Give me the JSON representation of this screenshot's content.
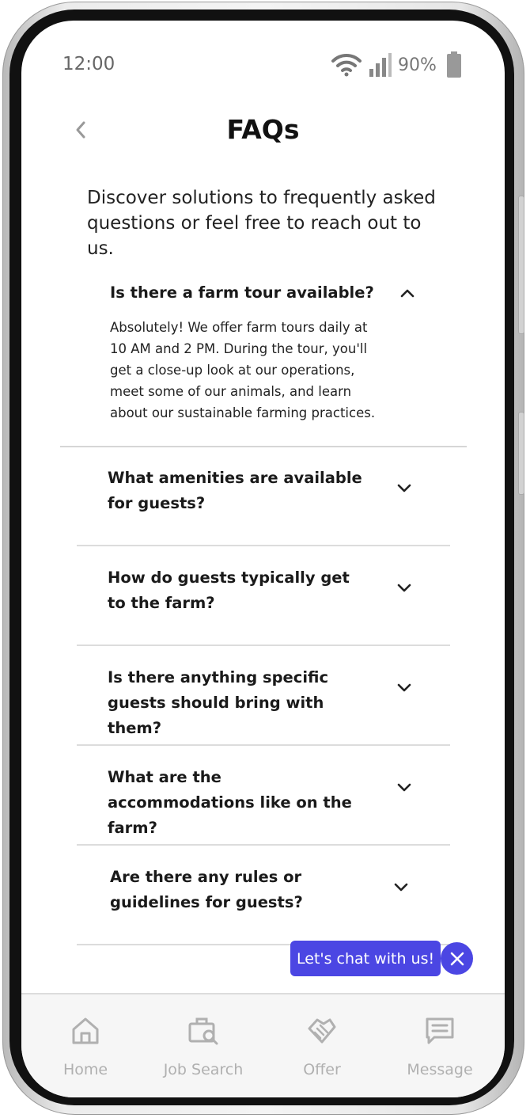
{
  "status_bar": {
    "time": "12:00",
    "battery_percent": "90%",
    "icons": [
      "wifi-icon",
      "signal-icon",
      "battery-icon"
    ]
  },
  "header": {
    "title": "FAQs",
    "back_icon": "chevron-left-icon"
  },
  "intro": "Discover solutions to frequently asked questions or feel free to reach out to us.",
  "faqs": {
    "open": {
      "question": "Is there a farm tour available?",
      "answer": "Absolutely! We offer farm tours daily at 10 AM and 2 PM. During the tour, you'll get a close-up look at our operations, meet some of our animals, and learn about our sustainable farming practices."
    },
    "items": [
      {
        "question": "What amenities are available for guests?"
      },
      {
        "question": "How do guests typically get to the farm?"
      },
      {
        "question": "Is there anything specific guests should bring with them?"
      },
      {
        "question": "What are the accommodations like on the farm?"
      },
      {
        "question": "Are there any rules or guidelines for guests?"
      }
    ]
  },
  "chat": {
    "label": "Let's chat with us!",
    "close_icon": "close-icon"
  },
  "tabbar": {
    "tabs": [
      {
        "label": "Home",
        "icon": "home-icon"
      },
      {
        "label": "Job Search",
        "icon": "job-search-icon"
      },
      {
        "label": "Offer",
        "icon": "handshake-icon"
      },
      {
        "label": "Message",
        "icon": "message-icon"
      }
    ]
  },
  "colors": {
    "accent": "#4b46e3",
    "tab_inactive": "#b0b0b0"
  }
}
